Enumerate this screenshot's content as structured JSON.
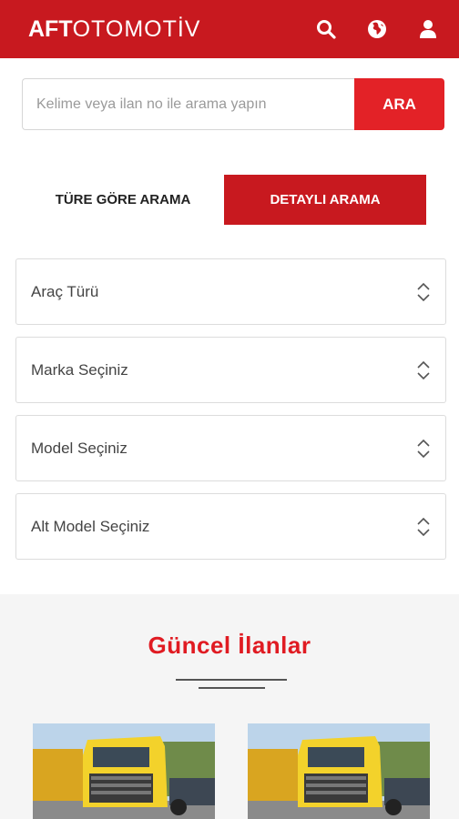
{
  "header": {
    "logo_bold": "AFT",
    "logo_light": "OTOMOTİV",
    "icons": [
      "search-icon",
      "globe-icon",
      "user-icon"
    ]
  },
  "search": {
    "placeholder": "Kelime veya ilan no ile arama yapın",
    "value": "",
    "button_label": "ARA"
  },
  "tabs": [
    {
      "label": "TÜRE GÖRE ARAMA",
      "active": false
    },
    {
      "label": "DETAYLI ARAMA",
      "active": true
    }
  ],
  "filters": [
    {
      "label": "Araç Türü"
    },
    {
      "label": "Marka Seçiniz"
    },
    {
      "label": "Model Seçiniz"
    },
    {
      "label": "Alt Model Seçiniz"
    }
  ],
  "listings": {
    "title": "Güncel İlanlar"
  },
  "colors": {
    "brand_red": "#c8191f",
    "button_red": "#e32227",
    "title_red": "#e01b22",
    "section_bg": "#f5f5f5"
  }
}
